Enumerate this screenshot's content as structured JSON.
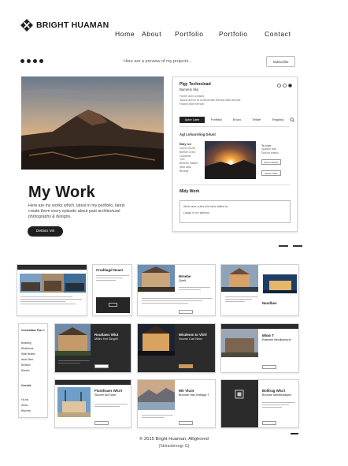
{
  "brand": {
    "name": "BRIGHT HUAMAN"
  },
  "nav": {
    "items": [
      "Home",
      "About",
      "Portfolio",
      "Portfolio",
      "Contact"
    ]
  },
  "subbar": {
    "text": "Here are a preview of my projects...",
    "button": "Subscribe"
  },
  "hero": {
    "title": "My Work",
    "description": "Here are my works which, latest in my portfolio, latest create them every episode about past architectural",
    "description_2": "photography & designs.",
    "button": "Dettion Vel"
  },
  "detail": {
    "title": "Plgy Technoload",
    "subtitle": "Bumeus Sky",
    "lines": [
      "Home and contact",
      "Jacca dreon ut a selvecilla finenal saw clemss",
      "Hotnin dine bendh"
    ],
    "tabs": [
      "Aptor Lane",
      "Portfiblo",
      "Bruno",
      "Teiblet",
      "Registra"
    ],
    "section": "Agl Lofoarrding Ditunt",
    "left_heading": "Bkly lce",
    "left_lines": [
      "Inionu Grunit",
      "Beeble Grett",
      "Cloldeste",
      "Tonl",
      "Brelinfo Gatled",
      "Wfut atlid",
      "Brivtaly"
    ],
    "right_heading": "Ts vine",
    "right_lines": [
      "Iquidenl lese",
      "Deuvra sneltio"
    ],
    "btn1": "Ecoro Nebert",
    "btn2": "Stolne Vebit",
    "mywork": "Mldy Work",
    "box_line1": "Wobr ane cutes the stew tafted la..",
    "box_line2": "Lakgo in en tpesion."
  },
  "cards": [
    {
      "title": "Crudtiagd Neact"
    },
    {
      "title": "Mrsebe",
      "sub": "Quelt"
    },
    {
      "title": "Neodbee"
    },
    {
      "title": "Routlaws Wlut",
      "sub": "Milllrs Hot Gingrill"
    },
    {
      "title": "Wisdeom to Vlirll",
      "sub": "Nosme Cart Neun"
    },
    {
      "title": "Mlow T",
      "sub": "Raesme Mbolllamprol"
    },
    {
      "title": "Flunthsaer Wha't",
      "sub": "Sioone Itut Note"
    },
    {
      "title": "Wir Vluot",
      "sub": "Brcome Nan Inellage T"
    },
    {
      "title": "Bolllrag Wha't",
      "sub": "Brcome Minitelolalpen"
    }
  ],
  "sidecard": {
    "lines": [
      "Condeatlass Fase 1",
      "Beabfolg",
      "Bleadhana",
      "Wiall Bettem",
      "Isnat Steel",
      "Bresene",
      "Bheshe",
      "Conside",
      "Fiy bis",
      "Wloss",
      "Biloness"
    ]
  },
  "footer": {
    "copyright": "© 2015 Bright Huaman, Allighored",
    "sub": "(Sbiraobreugr G)"
  }
}
